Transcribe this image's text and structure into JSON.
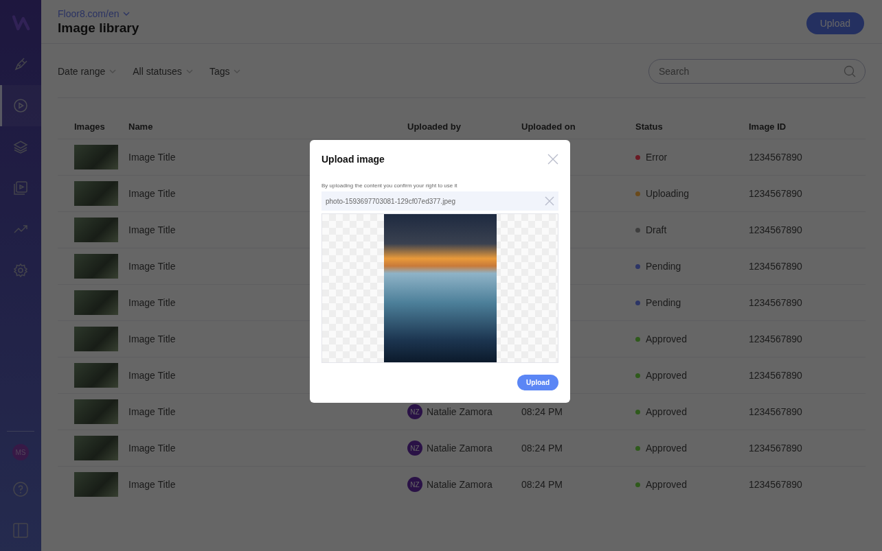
{
  "sidebar": {
    "items": [
      {
        "selected": false
      },
      {
        "selected": true
      },
      {
        "selected": false
      },
      {
        "selected": false
      },
      {
        "selected": false
      },
      {
        "selected": false
      }
    ],
    "avatar": "MS"
  },
  "header": {
    "site": "Floor8.com/en",
    "title": "Image library",
    "upload_button": "Upload"
  },
  "filters": [
    "Date range",
    "All statuses",
    "Tags"
  ],
  "search": {
    "placeholder": "Search"
  },
  "table": {
    "columns": [
      "Images",
      "Name",
      "Uploaded by",
      "Uploaded on",
      "Status",
      "Image ID"
    ],
    "rows": [
      {
        "name": "Image Title",
        "status": "Error",
        "color": "#6a1a24",
        "image_id": "1234567890"
      },
      {
        "name": "Image Title",
        "status": "Uploading",
        "color": "#6a4a1c",
        "image_id": "1234567890"
      },
      {
        "name": "Image Title",
        "status": "Draft",
        "color": "#3e3e3e",
        "image_id": "1234567890"
      },
      {
        "name": "Image Title",
        "status": "Pending",
        "color": "#2c3566",
        "image_id": "1234567890"
      },
      {
        "name": "Image Title",
        "status": "Pending",
        "color": "#2c3566",
        "image_id": "1234567890"
      },
      {
        "name": "Image Title",
        "status": "Approved",
        "color": "#2f5a1c",
        "image_id": "1234567890"
      },
      {
        "name": "Image Title",
        "status": "Approved",
        "color": "#2f5a1c",
        "image_id": "1234567890"
      },
      {
        "name": "Image Title",
        "initials": "NZ",
        "uploaded_by": "Natalie Zamora",
        "uploaded_on": "08:24 PM",
        "status": "Approved",
        "color": "#2f5a1c",
        "image_id": "1234567890"
      },
      {
        "name": "Image Title",
        "initials": "NZ",
        "uploaded_by": "Natalie Zamora",
        "uploaded_on": "08:24 PM",
        "status": "Approved",
        "color": "#2f5a1c",
        "image_id": "1234567890"
      },
      {
        "name": "Image Title",
        "initials": "NZ",
        "uploaded_by": "Natalie Zamora",
        "uploaded_on": "08:24 PM",
        "status": "Approved",
        "color": "#2f5a1c",
        "image_id": "1234567890"
      }
    ]
  },
  "modal": {
    "title": "Upload image",
    "notice": "By uploading the content you confirm your right to use it",
    "file_name": "photo-1593697703081-129cf07ed377.jpeg",
    "upload_button": "Upload"
  }
}
